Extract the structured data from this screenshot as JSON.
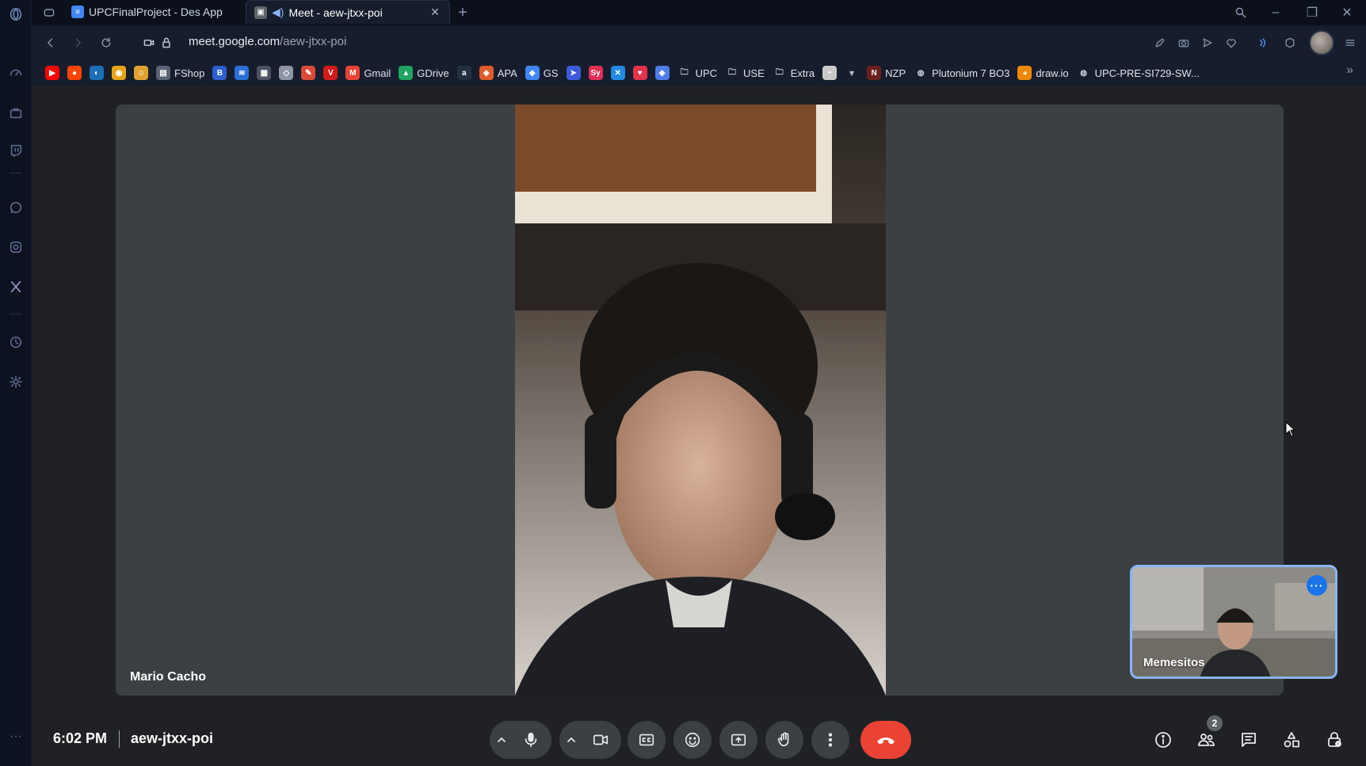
{
  "browser": {
    "tabs": [
      {
        "title": "UPCFinalProject - Des App",
        "favicon": "docs-icon",
        "active": false
      },
      {
        "title": "Meet - aew-jtxx-poi",
        "favicon": "meet-icon",
        "active": true
      }
    ],
    "url_prefix": "meet.google.com",
    "url_path": "/aew-jtxx-poi",
    "bookmarks": [
      {
        "label": "",
        "icon": "youtube-icon",
        "color": "#ff0000"
      },
      {
        "label": "",
        "icon": "reddit-icon",
        "color": "#ff4500"
      },
      {
        "label": "",
        "icon": "steam-icon",
        "color": "#1b6fb5"
      },
      {
        "label": "",
        "icon": "chrome-icon",
        "color": "#e8a317"
      },
      {
        "label": "",
        "icon": "smile-icon",
        "color": "#e0a12f"
      },
      {
        "label": "FShop",
        "icon": "fshop-icon",
        "color": "#5a6275"
      },
      {
        "label": "",
        "icon": "b-icon",
        "color": "#2e5fd1"
      },
      {
        "label": "",
        "icon": "stack-icon",
        "color": "#2c6fd6"
      },
      {
        "label": "",
        "icon": "item-icon",
        "color": "#4b5263"
      },
      {
        "label": "",
        "icon": "roblox-icon",
        "color": "#8c94a6"
      },
      {
        "label": "",
        "icon": "pen-icon",
        "color": "#d94a38"
      },
      {
        "label": "",
        "icon": "v-icon",
        "color": "#d21b1b"
      },
      {
        "label": "Gmail",
        "icon": "gmail-icon",
        "color": "#ea4335"
      },
      {
        "label": "GDrive",
        "icon": "gdrive-icon",
        "color": "#1fa463"
      },
      {
        "label": "",
        "icon": "amazon-icon",
        "color": "#232f3e"
      },
      {
        "label": "APA",
        "icon": "apa-icon",
        "color": "#e05a2b"
      },
      {
        "label": "GS",
        "icon": "gs-icon",
        "color": "#4285f4"
      },
      {
        "label": "",
        "icon": "arrow-bookmark-icon",
        "color": "#3d5bd9"
      },
      {
        "label": "",
        "icon": "sy-icon",
        "color": "#e52d54"
      },
      {
        "label": "",
        "icon": "x-box-icon",
        "color": "#1f8be0"
      },
      {
        "label": "",
        "icon": "heart-gem-icon",
        "color": "#e2334a"
      },
      {
        "label": "",
        "icon": "gem-icon",
        "color": "#4f7de8"
      },
      {
        "label": "UPC",
        "icon": "folder-icon",
        "color": "transparent"
      },
      {
        "label": "USE",
        "icon": "folder-icon",
        "color": "transparent"
      },
      {
        "label": "Extra",
        "icon": "folder-icon",
        "color": "transparent"
      },
      {
        "label": "",
        "icon": "mask-icon",
        "color": "#c9c9c9"
      },
      {
        "label": "",
        "icon": "filter-icon",
        "color": "transparent"
      },
      {
        "label": "NZP",
        "icon": "nzp-icon",
        "color": "#6b1f1f"
      },
      {
        "label": "Plutonium 7 BO3",
        "icon": "github-icon",
        "color": "transparent"
      },
      {
        "label": "draw.io",
        "icon": "drawio-icon",
        "color": "#f08705"
      },
      {
        "label": "UPC-PRE-SI729-SW...",
        "icon": "github-icon",
        "color": "transparent"
      }
    ],
    "sidebar_icons": [
      "opera-logo-icon",
      "speed-dial-icon",
      "shopping-bag-icon",
      "twitch-icon",
      "whatsapp-icon",
      "instagram-icon",
      "x-twitter-icon",
      "history-icon",
      "settings-icon",
      "more-icon"
    ]
  },
  "meet": {
    "participant_name": "Mario Cacho",
    "self_name": "Memesitos",
    "time": "6:02 PM",
    "meeting_code": "aew-jtxx-poi",
    "people_count": "2",
    "colors": {
      "background": "#202124",
      "tile": "#3c4043",
      "end_call": "#ea4335",
      "accent": "#8ab4f8"
    }
  }
}
